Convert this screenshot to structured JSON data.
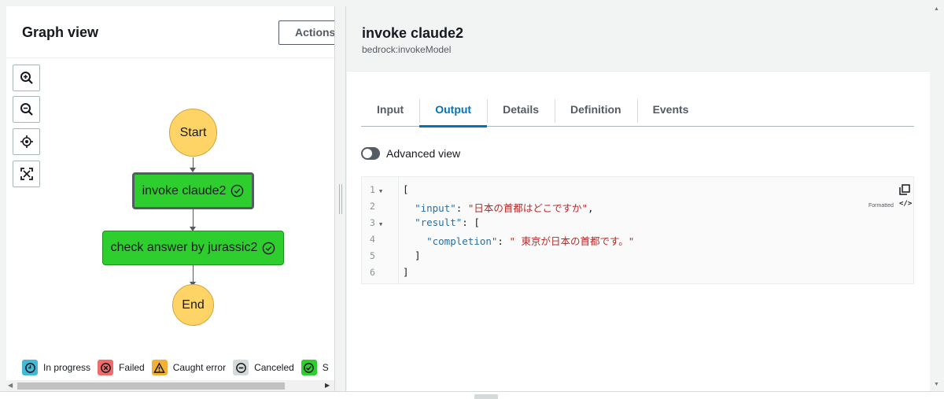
{
  "graph": {
    "title": "Graph view",
    "actions_label": "Actions",
    "nodes": {
      "start": "Start",
      "invoke": "invoke claude2",
      "check": "check answer by jurassic2",
      "end": "End"
    },
    "controls": [
      "zoom-in-icon",
      "zoom-out-icon",
      "center-icon",
      "fit-icon"
    ]
  },
  "legend": [
    {
      "label": "In progress",
      "color": "#44b9d6"
    },
    {
      "label": "Failed",
      "color": "#f06b6b"
    },
    {
      "label": "Caught error",
      "color": "#f2b03a"
    },
    {
      "label": "Canceled",
      "color": "#d5dbdb"
    },
    {
      "label": "S",
      "color": "#2ece2e"
    }
  ],
  "step": {
    "title": "invoke claude2",
    "subtitle": "bedrock:invokeModel"
  },
  "tabs": [
    {
      "label": "Input",
      "active": false
    },
    {
      "label": "Output",
      "active": true
    },
    {
      "label": "Details",
      "active": false
    },
    {
      "label": "Definition",
      "active": false
    },
    {
      "label": "Events",
      "active": false
    }
  ],
  "advanced_view_label": "Advanced view",
  "code": {
    "formatted_label": "Formatted",
    "lines": [
      {
        "num": "1",
        "fold": true
      },
      {
        "num": "2",
        "fold": false
      },
      {
        "num": "3",
        "fold": true
      },
      {
        "num": "4",
        "fold": false
      },
      {
        "num": "5",
        "fold": false
      },
      {
        "num": "6",
        "fold": false
      }
    ],
    "input_key": "\"input\"",
    "input_value": "\"日本の首都はどこですか\"",
    "result_key": "\"result\"",
    "completion_key": "\"completion\"",
    "completion_value": "\" 東京が日本の首都です。\""
  }
}
